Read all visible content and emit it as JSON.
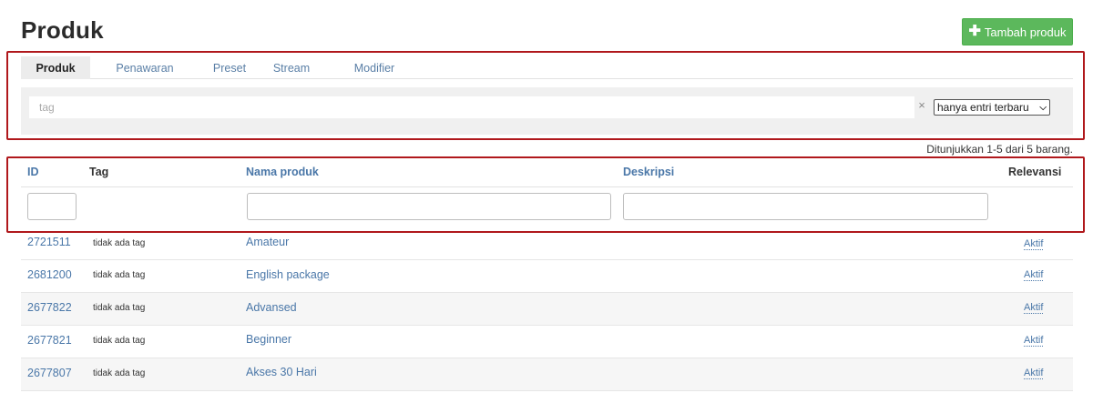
{
  "page": {
    "title": "Produk",
    "add_button": "Tambah produk"
  },
  "tabs": [
    {
      "label": "Produk",
      "active": true
    },
    {
      "label": "Penawaran",
      "active": false
    },
    {
      "label": "Preset",
      "active": false
    },
    {
      "label": "Stream",
      "active": false
    },
    {
      "label": "Modifier",
      "active": false
    }
  ],
  "filter": {
    "tag_placeholder": "tag",
    "clear_symbol": "×",
    "entry_select": "hanya entri terbaru"
  },
  "summary": "Ditunjukkan 1-5 dari 5 barang.",
  "table": {
    "headers": {
      "id": "ID",
      "tag": "Tag",
      "name": "Nama produk",
      "description": "Deskripsi",
      "relevance": "Relevansi"
    },
    "rows": [
      {
        "id": "2721511",
        "tag": "tidak ada tag",
        "name": "Amateur",
        "status": "Aktif"
      },
      {
        "id": "2681200",
        "tag": "tidak ada tag",
        "name": "English package",
        "status": "Aktif"
      },
      {
        "id": "2677822",
        "tag": "tidak ada tag",
        "name": "Advansed",
        "status": "Aktif"
      },
      {
        "id": "2677821",
        "tag": "tidak ada tag",
        "name": "Beginner",
        "status": "Aktif"
      },
      {
        "id": "2677807",
        "tag": "tidak ada tag",
        "name": "Akses 30 Hari",
        "status": "Aktif"
      }
    ]
  },
  "colors": {
    "primary_link": "#4a77a8",
    "add_button": "#5cb85c",
    "highlight_box": "#b0181c"
  },
  "icons": {
    "add": "plus-icon",
    "clear": "close-icon",
    "select": "chevron-down-icon"
  }
}
